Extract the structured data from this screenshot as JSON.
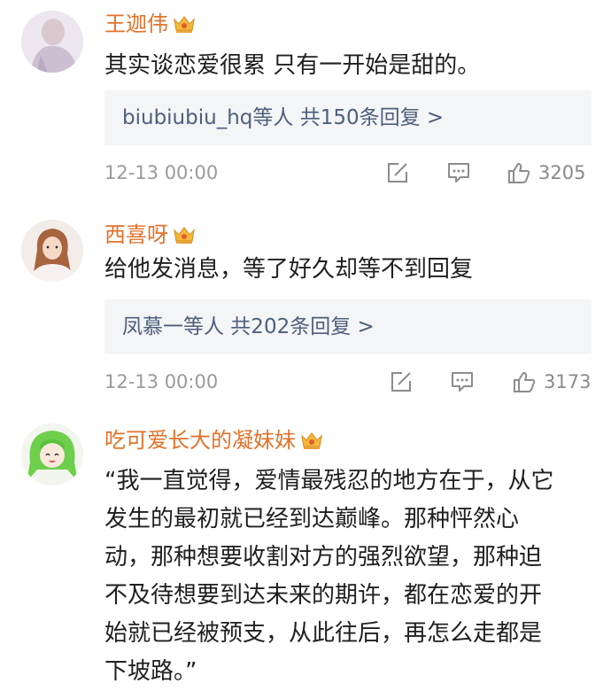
{
  "comments": [
    {
      "username": "王迦伟",
      "lines": [
        "其实谈恋爱很累 只有一开始是甜的。"
      ],
      "replies": "biubiubiu_hq等人 共150条回复 >",
      "time": "12-13 00:00",
      "likes": "3205"
    },
    {
      "username": "西喜呀",
      "lines": [
        "给他发消息，等了好久却等不到回复"
      ],
      "replies": "凤慕一等人 共202条回复 >",
      "time": "12-13 00:00",
      "likes": "3173"
    },
    {
      "username": "吃可爱长大的凝妹妹",
      "lines": [
        "“我一直觉得，爱情最残忍的地方在于，从它",
        "发生的最初就已经到达巅峰。那种怦然心",
        "动，那种想要收割对方的强烈欲望，那种迫",
        "不及待想要到达未来的期许，都在恋爱的开",
        "始就已经被预支，从此往后，再怎么走都是",
        "下坡路。”"
      ]
    }
  ],
  "icons": {
    "crown": "crown-badge-icon",
    "share": "share-edit-icon",
    "comment": "comment-bubble-icon",
    "like": "thumbs-up-icon"
  },
  "colors": {
    "username": "#e2722a",
    "replies": "#4d5f7c",
    "replies_bg": "#f4f5f7",
    "meta": "#9a9a9a"
  }
}
